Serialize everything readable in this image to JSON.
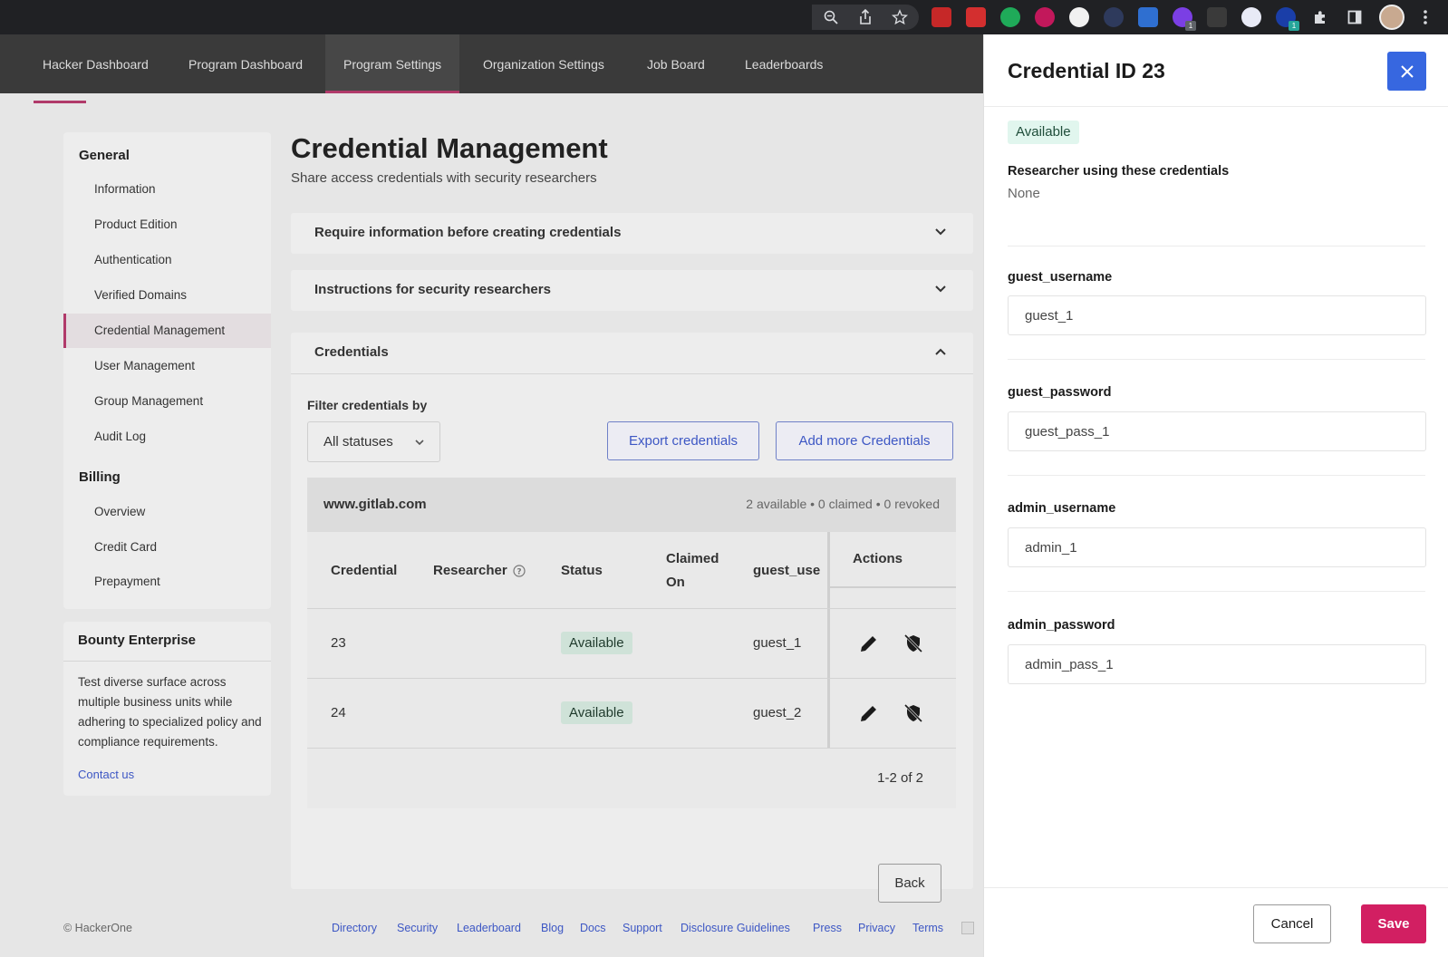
{
  "nav": {
    "items": [
      "Hacker Dashboard",
      "Program Dashboard",
      "Program Settings",
      "Organization Settings",
      "Job Board",
      "Leaderboards"
    ],
    "active": "Program Settings"
  },
  "sidebar": {
    "general_title": "General",
    "general_items": [
      "Information",
      "Product Edition",
      "Authentication",
      "Verified Domains",
      "Credential Management",
      "User Management",
      "Group Management",
      "Audit Log"
    ],
    "billing_title": "Billing",
    "billing_items": [
      "Overview",
      "Credit Card",
      "Prepayment"
    ]
  },
  "bounty": {
    "title": "Bounty Enterprise",
    "text": "Test diverse surface across multiple business units while adhering to specialized policy and compliance requirements.",
    "link": "Contact us"
  },
  "page": {
    "title": "Credential Management",
    "subtitle": "Share access credentials with security researchers",
    "accordion_require": "Require information before creating credentials",
    "accordion_instructions": "Instructions for security researchers",
    "accordion_credentials": "Credentials",
    "filter_label": "Filter credentials by",
    "filter_value": "All statuses",
    "export_label": "Export credentials",
    "add_label": "Add more Credentials",
    "back_label": "Back"
  },
  "table": {
    "domain": "www.gitlab.com",
    "counts": "2 available • 0 claimed • 0 revoked",
    "headers": {
      "credential": "Credential",
      "researcher": "Researcher",
      "status": "Status",
      "claimed_1": "Claimed",
      "claimed_2": "On",
      "guest": "guest_use",
      "actions": "Actions"
    },
    "rows": [
      {
        "credential": "23",
        "status": "Available",
        "guest": "guest_1"
      },
      {
        "credential": "24",
        "status": "Available",
        "guest": "guest_2"
      }
    ],
    "pager": "1-2 of 2"
  },
  "footer": {
    "copyright": "© HackerOne",
    "links": [
      "Directory",
      "Security",
      "Leaderboard",
      "Blog",
      "Docs",
      "Support",
      "Disclosure Guidelines",
      "Press",
      "Privacy",
      "Terms"
    ]
  },
  "drawer": {
    "title": "Credential ID 23",
    "status": "Available",
    "researcher_label": "Researcher using these credentials",
    "researcher_value": "None",
    "fields": [
      {
        "label": "guest_username",
        "value": "guest_1"
      },
      {
        "label": "guest_password",
        "value": "guest_pass_1"
      },
      {
        "label": "admin_username",
        "value": "admin_1"
      },
      {
        "label": "admin_password",
        "value": "admin_pass_1"
      }
    ],
    "cancel_label": "Cancel",
    "save_label": "Save"
  },
  "colors": {
    "accent_pink": "#d21f62",
    "accent_blue": "#3767e0",
    "status_green_bg": "#e1f6ee"
  },
  "icons": [
    "zoom-icon",
    "share-icon",
    "star-icon",
    "puzzle-icon",
    "more-vertical-icon",
    "close-icon",
    "chevron-down-icon",
    "chevron-up-icon",
    "help-circle-icon",
    "pencil-icon",
    "revoke-icon"
  ]
}
